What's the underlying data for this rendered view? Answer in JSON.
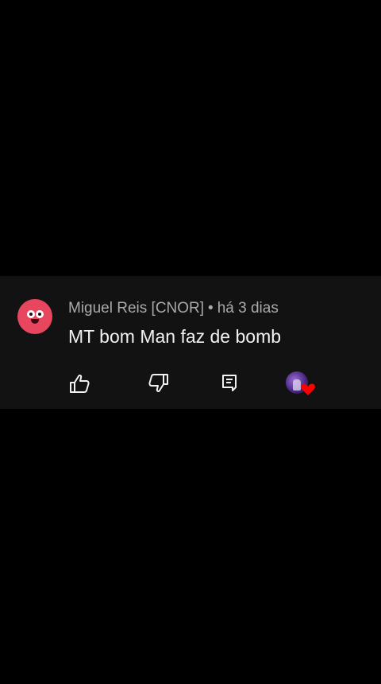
{
  "comment": {
    "author": "Miguel Reis [CNOR]",
    "separator": "•",
    "time": "há 3 dias",
    "text": "MT bom Man faz de bomb"
  },
  "actions": {
    "like_icon": "thumbs-up-icon",
    "dislike_icon": "thumbs-down-icon",
    "reply_icon": "reply-comment-icon",
    "creator_heart_icon": "creator-heart-icon"
  },
  "colors": {
    "page_background": "#000000",
    "card_background": "#121212",
    "meta_text": "#aaaaaa",
    "body_text": "#f1f1f1",
    "avatar": "#e8455e",
    "heart": "#ff0000"
  }
}
